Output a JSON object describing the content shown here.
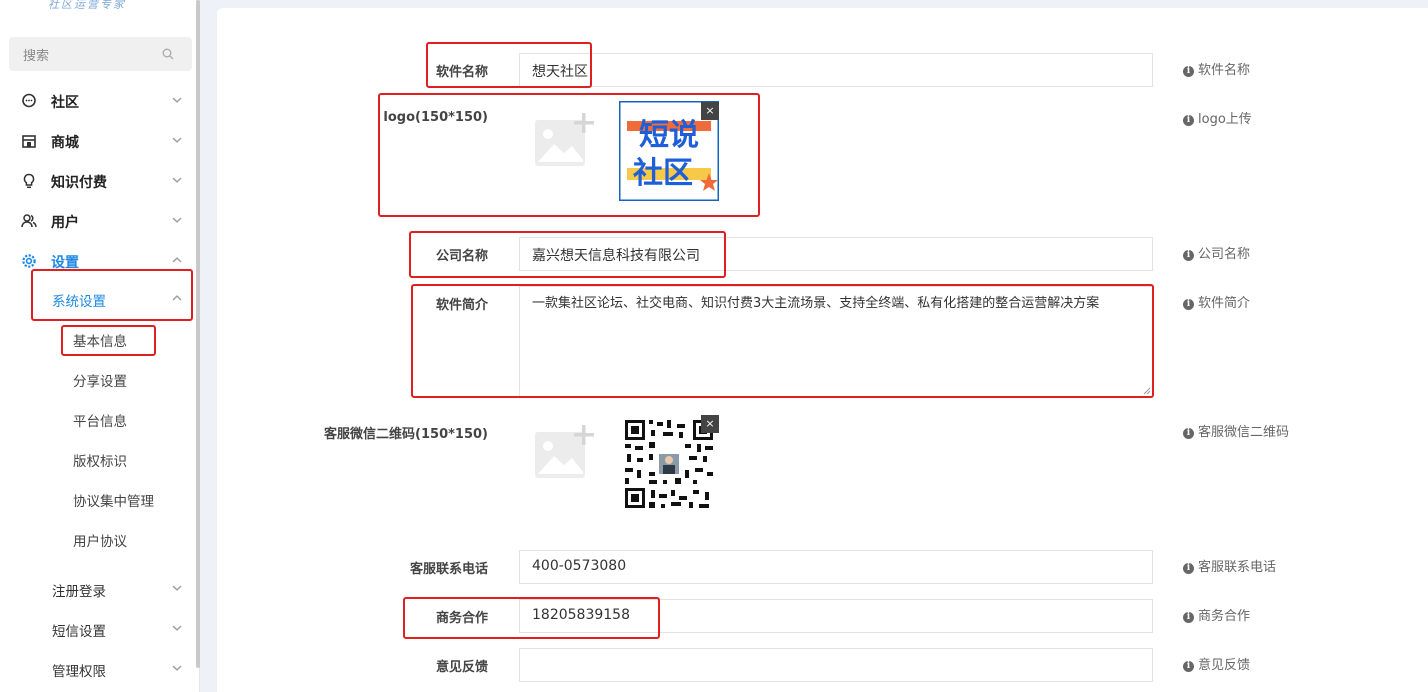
{
  "sidebar": {
    "logo_text": "社区运营专家",
    "search_placeholder": "搜索",
    "menu": [
      {
        "label": "社区",
        "icon": "chat-icon"
      },
      {
        "label": "商城",
        "icon": "store-icon"
      },
      {
        "label": "知识付费",
        "icon": "lightbulb-icon"
      },
      {
        "label": "用户",
        "icon": "users-icon"
      },
      {
        "label": "设置",
        "icon": "gear-icon"
      }
    ],
    "settings_sub": {
      "system": "系统设置",
      "leaves": [
        "基本信息",
        "分享设置",
        "平台信息",
        "版权标识",
        "协议集中管理",
        "用户协议"
      ],
      "others": [
        "注册登录",
        "短信设置",
        "管理权限"
      ]
    }
  },
  "form": {
    "software_name": {
      "label": "软件名称",
      "value": "想天社区",
      "hint": "软件名称"
    },
    "logo": {
      "label": "logo(150*150)",
      "hint": "logo上传",
      "image_text_line1": "短说",
      "image_text_line2": "社区"
    },
    "company": {
      "label": "公司名称",
      "value": "嘉兴想天信息科技有限公司",
      "hint": "公司名称"
    },
    "intro": {
      "label": "软件简介",
      "value": "一款集社区论坛、社交电商、知识付费3大主流场景、支持全终端、私有化搭建的整合运营解决方案",
      "hint": "软件简介"
    },
    "qrcode": {
      "label": "客服微信二维码(150*150)",
      "hint": "客服微信二维码"
    },
    "phone": {
      "label": "客服联系电话",
      "value": "400-0573080",
      "hint": "客服联系电话"
    },
    "business": {
      "label": "商务合作",
      "value": "18205839158",
      "hint": "商务合作"
    },
    "feedback": {
      "label": "意见反馈",
      "value": "",
      "hint": "意见反馈"
    }
  },
  "colors": {
    "accent": "#1e88e5",
    "highlight": "#e02020"
  }
}
